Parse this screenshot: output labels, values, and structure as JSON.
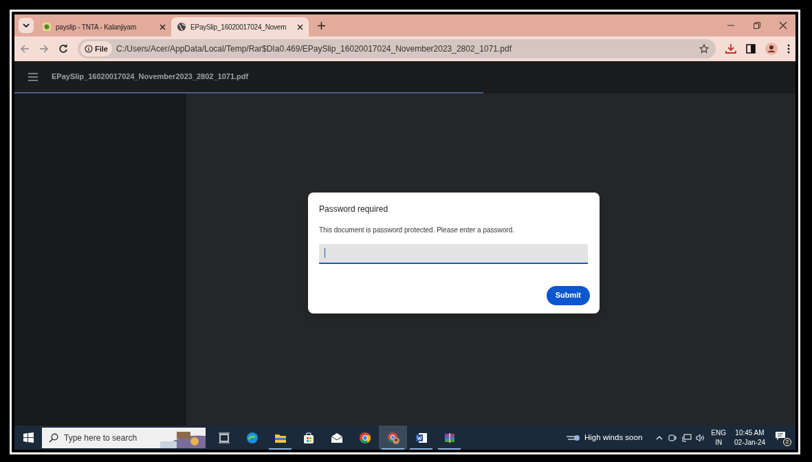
{
  "browser": {
    "tabs": [
      {
        "title": "payslip - TNTA - Kalanjiyam",
        "selected": false,
        "kind": "emblem"
      },
      {
        "title": "EPaySlip_16020017024_Novem",
        "selected": true,
        "kind": "globe"
      }
    ],
    "address": {
      "scheme": "File",
      "url": "C:/Users/Acer/AppData/Local/Temp/Rar$DIa0.469/EPaySlip_16020017024_November2023_2802_1071.pdf"
    }
  },
  "pdf_viewer": {
    "title": "EPaySlip_16020017024_November2023_2802_1071.pdf",
    "load_progress": {
      "level": 0.6
    }
  },
  "dialog": {
    "title": "Password required",
    "message": "This document is password protected. Please enter a password.",
    "button": "Submit"
  },
  "taskbar": {
    "search_placeholder": "Type here to search",
    "apps": [
      {
        "kind": "taskview",
        "open": false,
        "selected": false
      },
      {
        "kind": "edge",
        "open": false,
        "selected": false
      },
      {
        "kind": "explorer",
        "open": true,
        "selected": false
      },
      {
        "kind": "store",
        "open": false,
        "selected": false
      },
      {
        "kind": "mail",
        "open": false,
        "selected": false
      },
      {
        "kind": "chrome",
        "open": false,
        "selected": false
      },
      {
        "kind": "chrome-profile",
        "open": true,
        "selected": true
      },
      {
        "kind": "word",
        "open": true,
        "selected": false
      },
      {
        "kind": "winrar",
        "open": true,
        "selected": false
      }
    ],
    "weather": "High winds soon",
    "language": "ENG",
    "region": "IN",
    "time": "10:45 AM",
    "date": "02-Jan-24",
    "notifications": "2"
  }
}
